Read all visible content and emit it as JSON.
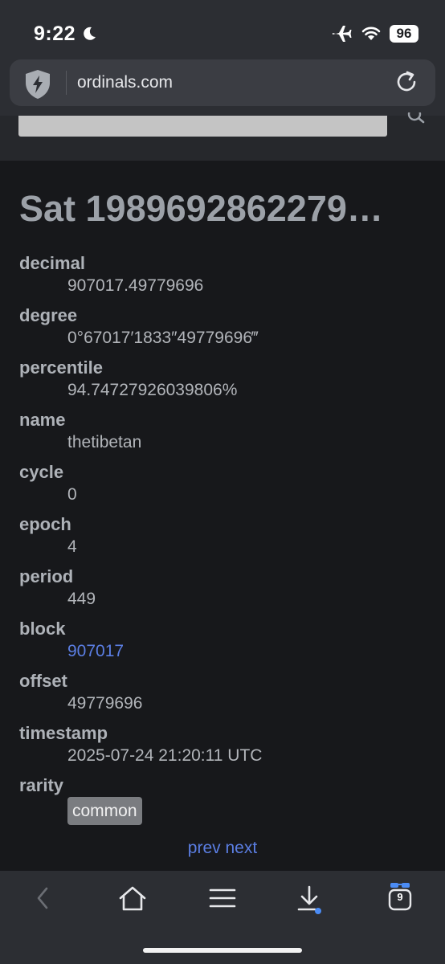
{
  "status_bar": {
    "time": "9:22",
    "battery": "96"
  },
  "browser": {
    "url": "ordinals.com",
    "tab_count": "9"
  },
  "page": {
    "title": "Sat 1989692862279…",
    "fields": [
      {
        "label": "decimal",
        "value": "907017.49779696"
      },
      {
        "label": "degree",
        "value": "0°67017′1833″49779696‴"
      },
      {
        "label": "percentile",
        "value": "94.74727926039806%"
      },
      {
        "label": "name",
        "value": "thetibetan"
      },
      {
        "label": "cycle",
        "value": "0"
      },
      {
        "label": "epoch",
        "value": "4"
      },
      {
        "label": "period",
        "value": "449"
      },
      {
        "label": "block",
        "value": "907017"
      },
      {
        "label": "offset",
        "value": "49779696"
      },
      {
        "label": "timestamp",
        "value": "2025-07-24 21:20:11 UTC"
      },
      {
        "label": "rarity",
        "value": "common"
      }
    ],
    "prev_label": "prev",
    "next_label": "next"
  },
  "colors": {
    "link": "#5b7ee3",
    "background": "#17181b",
    "chrome": "#2c2e33"
  },
  "icons": [
    "moon-icon",
    "airplane-icon",
    "wifi-icon",
    "shield-icon",
    "reload-icon",
    "search-icon",
    "back-icon",
    "home-icon",
    "menu-icon",
    "download-icon",
    "tabs-icon"
  ]
}
